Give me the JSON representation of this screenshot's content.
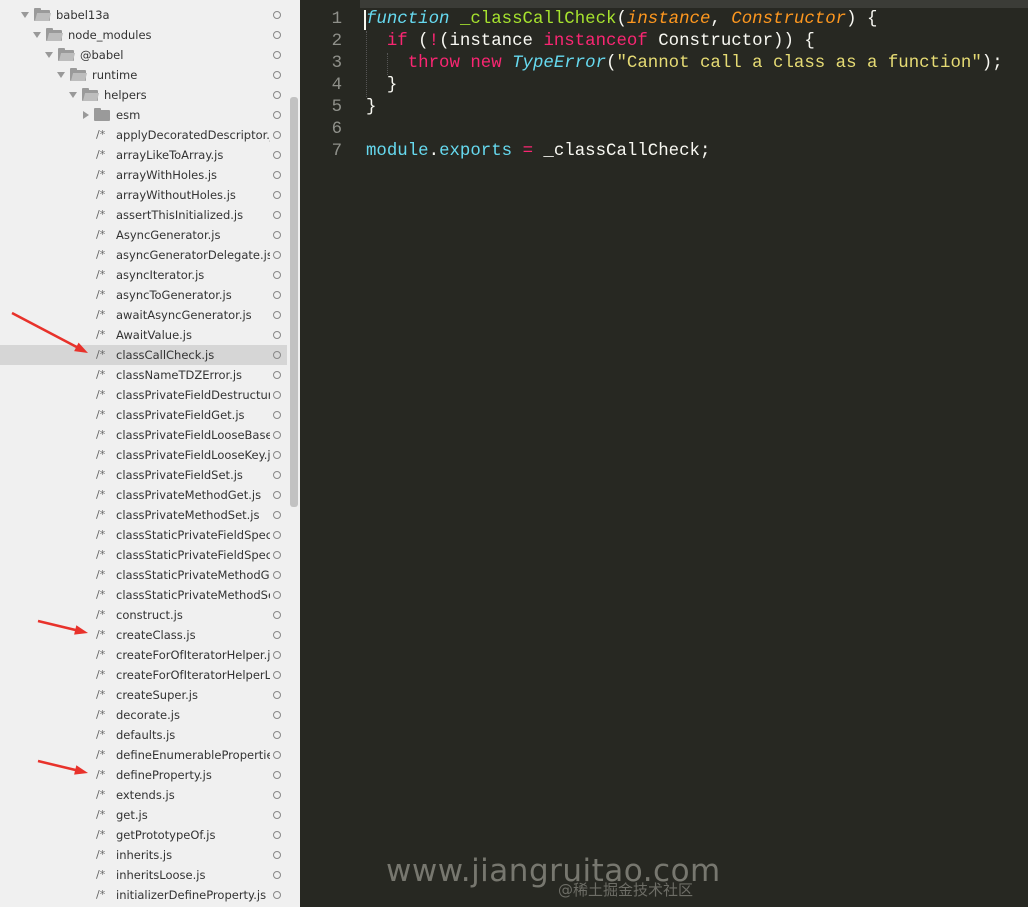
{
  "tree": {
    "folders": [
      {
        "name": "babel13a",
        "state": "open",
        "depth": 0
      },
      {
        "name": "node_modules",
        "state": "open",
        "depth": 1
      },
      {
        "name": "@babel",
        "state": "open",
        "depth": 2
      },
      {
        "name": "runtime",
        "state": "open",
        "depth": 3
      },
      {
        "name": "helpers",
        "state": "open",
        "depth": 4
      },
      {
        "name": "esm",
        "state": "closed",
        "depth": 5
      }
    ],
    "file_prefix": "/*",
    "selected": "classCallCheck.js",
    "files": [
      "applyDecoratedDescriptor.js",
      "arrayLikeToArray.js",
      "arrayWithHoles.js",
      "arrayWithoutHoles.js",
      "assertThisInitialized.js",
      "AsyncGenerator.js",
      "asyncGeneratorDelegate.js",
      "asyncIterator.js",
      "asyncToGenerator.js",
      "awaitAsyncGenerator.js",
      "AwaitValue.js",
      "classCallCheck.js",
      "classNameTDZError.js",
      "classPrivateFieldDestructureSet.js",
      "classPrivateFieldGet.js",
      "classPrivateFieldLooseBase.js",
      "classPrivateFieldLooseKey.js",
      "classPrivateFieldSet.js",
      "classPrivateMethodGet.js",
      "classPrivateMethodSet.js",
      "classStaticPrivateFieldSpecGet.js",
      "classStaticPrivateFieldSpecSet.js",
      "classStaticPrivateMethodGet.js",
      "classStaticPrivateMethodSet.js",
      "construct.js",
      "createClass.js",
      "createForOfIteratorHelper.js",
      "createForOfIteratorHelperLoose.js",
      "createSuper.js",
      "decorate.js",
      "defaults.js",
      "defineEnumerableProperties.js",
      "defineProperty.js",
      "extends.js",
      "get.js",
      "getPrototypeOf.js",
      "inherits.js",
      "inheritsLoose.js",
      "initializerDefineProperty.js"
    ],
    "highlighted_with_arrow": [
      "classCallCheck.js",
      "createClass.js",
      "defineProperty.js"
    ]
  },
  "editor": {
    "lines": [
      [
        [
          "function",
          "kw"
        ],
        [
          " ",
          "pl"
        ],
        [
          "_classCallCheck",
          "fn"
        ],
        [
          "(",
          "pl"
        ],
        [
          "instance",
          "pa"
        ],
        [
          ", ",
          "pl"
        ],
        [
          "Constructor",
          "pa"
        ],
        [
          ") {",
          "pl"
        ]
      ],
      [
        [
          "  ",
          "pl"
        ],
        [
          "if",
          "pk"
        ],
        [
          " (",
          "pl"
        ],
        [
          "!",
          "pk"
        ],
        [
          "(instance ",
          "pl"
        ],
        [
          "instanceof",
          "pk"
        ],
        [
          " Constructor)) {",
          "pl"
        ]
      ],
      [
        [
          "    ",
          "pl"
        ],
        [
          "throw",
          "pk"
        ],
        [
          " ",
          "pl"
        ],
        [
          "new",
          "pk"
        ],
        [
          " ",
          "pl"
        ],
        [
          "TypeError",
          "cyi"
        ],
        [
          "(",
          "pl"
        ],
        [
          "\"Cannot call a class as a function\"",
          "st"
        ],
        [
          ");",
          "pl"
        ]
      ],
      [
        [
          "  }",
          "pl"
        ]
      ],
      [
        [
          "}",
          "pl"
        ]
      ],
      [],
      [
        [
          "module",
          "cy"
        ],
        [
          ".",
          "pl"
        ],
        [
          "exports",
          "cy"
        ],
        [
          " ",
          "pl"
        ],
        [
          "=",
          "pk"
        ],
        [
          " _classCallCheck;",
          "pl"
        ]
      ]
    ]
  },
  "watermark": {
    "site": "www.jiangruitao.com",
    "community": "@稀土掘金技术社区"
  },
  "colors": {
    "arrow": "#e8322b",
    "editor_bg": "#272822"
  }
}
